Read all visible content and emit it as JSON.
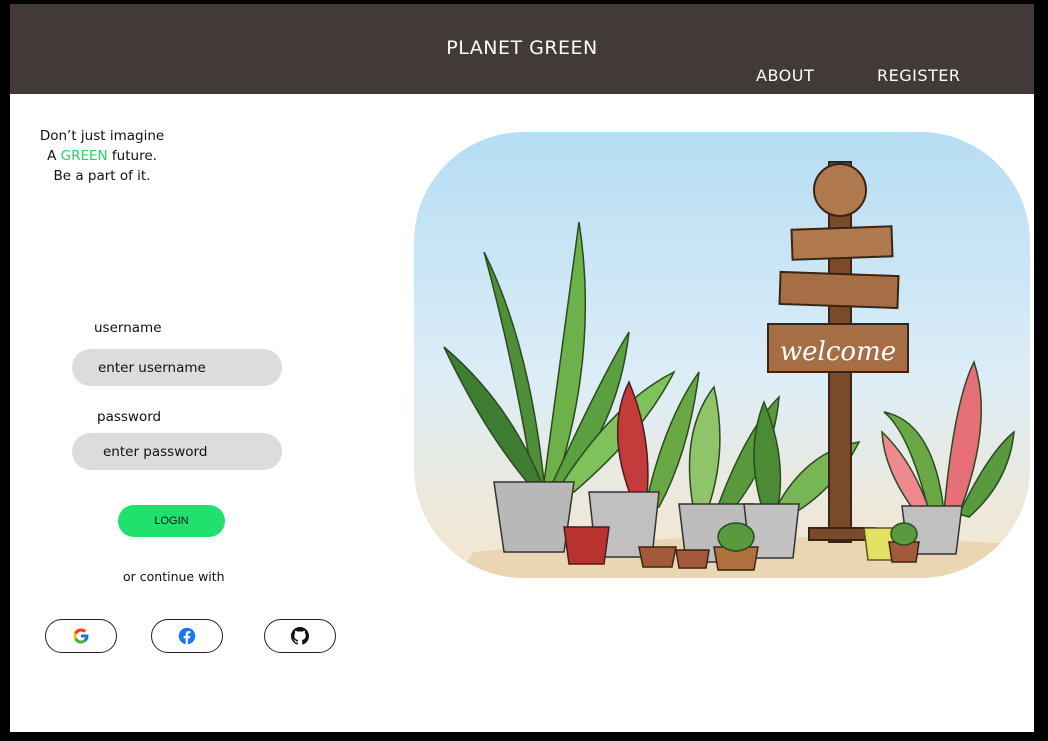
{
  "header": {
    "brand": "PLANET GREEN",
    "nav": [
      "ABOUT",
      "REGISTER"
    ]
  },
  "tagline": {
    "line1": "Don’t just imagine",
    "line2_prefix": "A",
    "line2_highlight": "GREEN",
    "line2_suffix": "future.",
    "line3": "Be a part of it."
  },
  "login_form": {
    "username_label": "username",
    "username_placeholder": "enter username",
    "password_label": "password",
    "password_placeholder": "enter password",
    "login_button": "LOGIN",
    "alt_text": "or continue with"
  },
  "social": [
    "google-icon",
    "facebook-icon",
    "github-icon"
  ],
  "illustration": {
    "sign_text": "welcome"
  },
  "colors": {
    "header_bg": "#423a38",
    "accent_green": "#22d46b",
    "login_green": "#22e06e",
    "field_bg": "#dcdcdc"
  }
}
